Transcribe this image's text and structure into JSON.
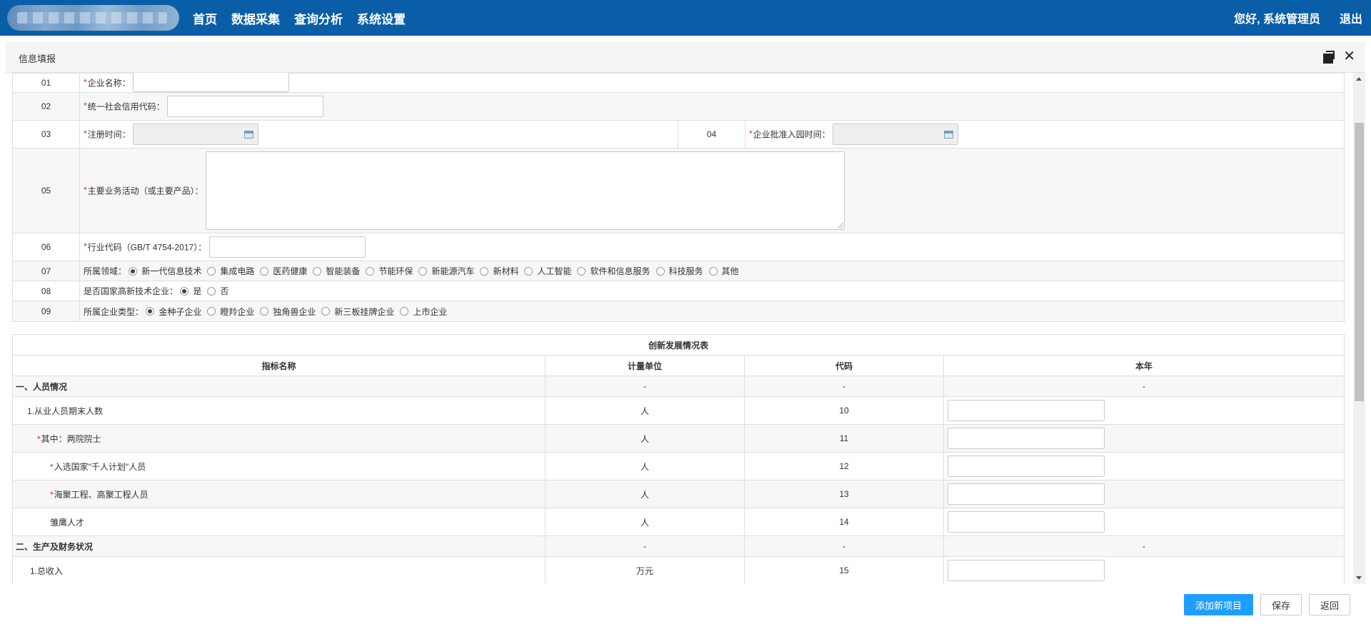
{
  "nav": {
    "items": [
      "首页",
      "数据采集",
      "查询分析",
      "系统设置"
    ],
    "greeting": "您好, 系统管理员",
    "logout": "退出"
  },
  "panel": {
    "title": "信息填报"
  },
  "form": {
    "rows": [
      {
        "num": "01",
        "label": "企业名称：",
        "required": true
      },
      {
        "num": "02",
        "label": "统一社会信用代码：",
        "required": true
      },
      {
        "num": "03",
        "label": "注册时间：",
        "required": true
      },
      {
        "num": "04",
        "label": "企业批准入园时间：",
        "required": true
      },
      {
        "num": "05",
        "label": "主要业务活动（或主要产品）：",
        "required": true
      },
      {
        "num": "06",
        "label": "行业代码（GB/T 4754-2017）：",
        "required": true
      },
      {
        "num": "07",
        "label": "所属领域：",
        "required": false
      },
      {
        "num": "08",
        "label": "是否国家高新技术企业：",
        "required": false
      },
      {
        "num": "09",
        "label": "所属企业类型：",
        "required": false
      }
    ],
    "field_options": [
      "新一代信息技术",
      "集成电路",
      "医药健康",
      "智能装备",
      "节能环保",
      "新能源汽车",
      "新材料",
      "人工智能",
      "软件和信息服务",
      "科技服务",
      "其他"
    ],
    "field_selected": "新一代信息技术",
    "hightech_options": [
      "是",
      "否"
    ],
    "hightech_selected": "是",
    "type_options": [
      "金种子企业",
      "瞪羚企业",
      "独角兽企业",
      "新三板挂牌企业",
      "上市企业"
    ],
    "type_selected": "金种子企业"
  },
  "innovation": {
    "title": "创新发展情况表",
    "headers": [
      "指标名称",
      "计量单位",
      "代码",
      "本年"
    ],
    "sections": [
      {
        "name": "一、人员情况",
        "unit": "-",
        "code": "-",
        "value": "-"
      },
      {
        "name": "二、生产及财务状况",
        "unit": "-",
        "code": "-",
        "value": "-"
      }
    ],
    "rows": [
      {
        "name": "1.从业人员期末人数",
        "unit": "人",
        "code": "10",
        "required": false
      },
      {
        "name": "其中：两院院士",
        "unit": "人",
        "code": "11",
        "required": true
      },
      {
        "name": "入选国家\"千人计划\"人员",
        "unit": "人",
        "code": "12",
        "required": true
      },
      {
        "name": "海聚工程、高聚工程人员",
        "unit": "人",
        "code": "13",
        "required": true
      },
      {
        "name": "雏鹰人才",
        "unit": "人",
        "code": "14",
        "required": false
      },
      {
        "name": "1.总收入",
        "unit": "万元",
        "code": "15",
        "required": false
      }
    ]
  },
  "footer": {
    "add_label": "添加新项目",
    "save_label": "保存",
    "back_label": "返回"
  },
  "colors": {
    "topbar": "#0a5ea8",
    "primary_button": "#1e9fff",
    "required_mark": "#e02020"
  }
}
